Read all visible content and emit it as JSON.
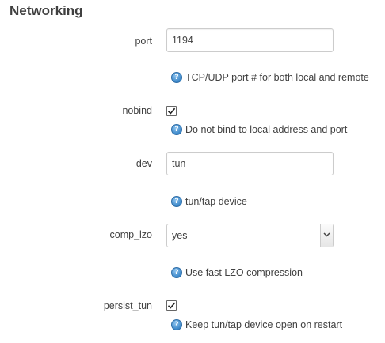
{
  "section": {
    "title": "Networking"
  },
  "fields": {
    "port": {
      "label": "port",
      "value": "1194",
      "hint": "TCP/UDP port # for both local and remote"
    },
    "nobind": {
      "label": "nobind",
      "checked": true,
      "hint": "Do not bind to local address and port"
    },
    "dev": {
      "label": "dev",
      "value": "tun",
      "hint": "tun/tap device"
    },
    "comp_lzo": {
      "label": "comp_lzo",
      "selected": "yes",
      "hint": "Use fast LZO compression"
    },
    "persist_tun": {
      "label": "persist_tun",
      "checked": true,
      "hint": "Keep tun/tap device open on restart"
    }
  },
  "icons": {
    "help": "help-icon",
    "check": "checkmark-icon",
    "dropdown": "chevron-down-icon"
  },
  "colors": {
    "text": "#404040",
    "border": "#cccccc",
    "help_icon": "#3a86c8"
  }
}
